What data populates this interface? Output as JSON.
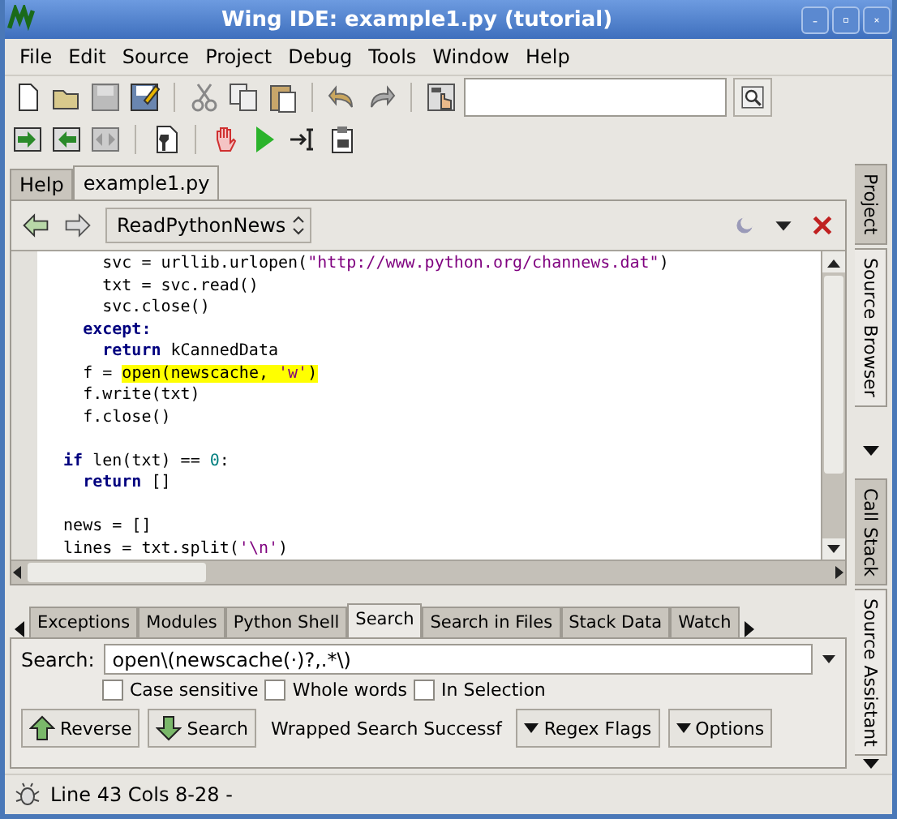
{
  "window": {
    "title": "Wing IDE: example1.py (tutorial)"
  },
  "menu": [
    "File",
    "Edit",
    "Source",
    "Project",
    "Debug",
    "Tools",
    "Window",
    "Help"
  ],
  "editor_tabs": [
    {
      "label": "Help",
      "selected": false
    },
    {
      "label": "example1.py",
      "selected": true
    }
  ],
  "function_selector": "ReadPythonNews",
  "code_lines": [
    {
      "kind": "code",
      "tokens": [
        {
          "text": "      svc = urllib.urlopen(",
          "kind": "plain"
        },
        {
          "text": "\"http://www.python.org/channews.dat\"",
          "kind": "str"
        },
        {
          "text": ")",
          "kind": "plain"
        }
      ]
    },
    {
      "kind": "code",
      "tokens": [
        {
          "text": "      txt = svc.read()",
          "kind": "plain"
        }
      ]
    },
    {
      "kind": "code",
      "tokens": [
        {
          "text": "      svc.close()",
          "kind": "plain"
        }
      ]
    },
    {
      "kind": "code",
      "tokens": [
        {
          "text": "    except:",
          "kind": "kw"
        }
      ]
    },
    {
      "kind": "code",
      "tokens": [
        {
          "text": "      return",
          "kind": "kw"
        },
        {
          "text": " kCannedData",
          "kind": "plain"
        }
      ]
    },
    {
      "kind": "code",
      "tokens": [
        {
          "text": "    f = ",
          "kind": "plain"
        },
        {
          "text": "open(newscache, ",
          "kind": "mark"
        },
        {
          "text": "'w'",
          "kind": "markstr"
        },
        {
          "text": ")",
          "kind": "mark"
        }
      ]
    },
    {
      "kind": "code",
      "tokens": [
        {
          "text": "    f.write(txt)",
          "kind": "plain"
        }
      ]
    },
    {
      "kind": "code",
      "tokens": [
        {
          "text": "    f.close()",
          "kind": "plain"
        }
      ]
    },
    {
      "kind": "blank"
    },
    {
      "kind": "code",
      "tokens": [
        {
          "text": "  if",
          "kind": "kw"
        },
        {
          "text": " len(txt) == ",
          "kind": "plain"
        },
        {
          "text": "0",
          "kind": "num"
        },
        {
          "text": ":",
          "kind": "plain"
        }
      ]
    },
    {
      "kind": "code",
      "tokens": [
        {
          "text": "    return",
          "kind": "kw"
        },
        {
          "text": " []",
          "kind": "plain"
        }
      ]
    },
    {
      "kind": "blank"
    },
    {
      "kind": "code",
      "tokens": [
        {
          "text": "  news = []",
          "kind": "plain"
        }
      ]
    },
    {
      "kind": "code",
      "tokens": [
        {
          "text": "  lines = txt.split(",
          "kind": "plain"
        },
        {
          "text": "'\\n'",
          "kind": "str"
        },
        {
          "text": ")",
          "kind": "plain"
        }
      ]
    }
  ],
  "tool_tabs": [
    {
      "label": "Exceptions",
      "selected": false
    },
    {
      "label": "Modules",
      "selected": false
    },
    {
      "label": "Python Shell",
      "selected": false
    },
    {
      "label": "Search",
      "selected": true
    },
    {
      "label": "Search in Files",
      "selected": false
    },
    {
      "label": "Stack Data",
      "selected": false
    },
    {
      "label": "Watch",
      "selected": false
    }
  ],
  "search": {
    "label": "Search:",
    "value": "open\\(newscache(·)?,.*\\)",
    "options": [
      {
        "label": "Case sensitive",
        "checked": false
      },
      {
        "label": "Whole words",
        "checked": false
      },
      {
        "label": "In Selection",
        "checked": false
      }
    ],
    "buttons": [
      {
        "label": "Reverse",
        "kind": "up"
      },
      {
        "label": "Search",
        "kind": "down"
      },
      {
        "label": "Wrapped Search Successf",
        "kind": "message"
      },
      {
        "label": "Regex Flags",
        "kind": "menu"
      },
      {
        "label": "Options",
        "kind": "menu"
      }
    ]
  },
  "side_tabs_upper": [
    {
      "label": "Project",
      "selected": false
    },
    {
      "label": "Source Browser",
      "selected": true
    }
  ],
  "side_tabs_lower": [
    {
      "label": "Call Stack",
      "selected": false
    },
    {
      "label": "Source Assistant",
      "selected": true
    }
  ],
  "status_bar": "Line 43 Cols 8-28 -"
}
